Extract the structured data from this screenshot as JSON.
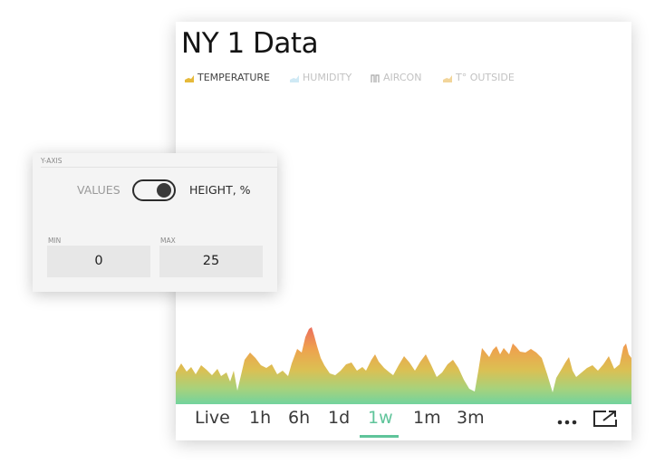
{
  "widget": {
    "title": "NY 1 Data",
    "legend": [
      {
        "label": "TEMPERATURE",
        "active": true,
        "color": "#e6b93a",
        "icon": "area-chart-icon"
      },
      {
        "label": "HUMIDITY",
        "active": false,
        "color": "#a7d7ef",
        "icon": "area-chart-icon"
      },
      {
        "label": "AIRCON",
        "active": false,
        "color": "#9a9a9a",
        "icon": "step-chart-icon"
      },
      {
        "label": "T° OUTSIDE",
        "active": false,
        "color": "#f0c46a",
        "icon": "area-chart-icon"
      }
    ],
    "time_ranges": [
      "Live",
      "1h",
      "6h",
      "1d",
      "1w",
      "1m",
      "3m"
    ],
    "active_range": "1w",
    "accent_color": "#5fc49a",
    "more_icon": "more-horizontal-icon",
    "expand_icon": "external-link-icon"
  },
  "yaxis_panel": {
    "title": "Y-AXIS",
    "toggle_left": "VALUES",
    "toggle_right": "HEIGHT, %",
    "toggle_on": true,
    "min_label": "MIN",
    "min_value": "0",
    "max_label": "MAX",
    "max_value": "25"
  }
}
